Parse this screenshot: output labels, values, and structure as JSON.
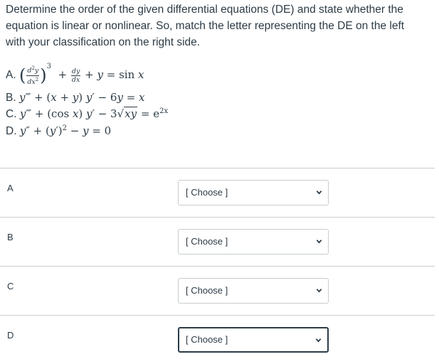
{
  "question": {
    "prompt_lines": [
      "Determine the order of the given differential equations (DE) and state whether the",
      "equation is linear or nonlinear. So, match the letter representing the DE on the left",
      "with your classification on the right side."
    ]
  },
  "equations": [
    {
      "letter": "A.",
      "latex": "(d^2y/dx^2)^3 + dy/dx + y = sin x"
    },
    {
      "letter": "B.",
      "latex": "y''' + (x + y) y' − 6y = x"
    },
    {
      "letter": "C.",
      "latex": "y''' + (cos x) y' − 3√(xy) = e^(2x)"
    },
    {
      "letter": "D.",
      "latex": "y'' + (y')^2 − y = 0"
    }
  ],
  "matches": [
    {
      "label": "A",
      "selected": "[ Choose ]"
    },
    {
      "label": "B",
      "selected": "[ Choose ]"
    },
    {
      "label": "C",
      "selected": "[ Choose ]"
    },
    {
      "label": "D",
      "selected": "[ Choose ]"
    }
  ],
  "colors": {
    "text": "#2d3b45",
    "divider": "#c7cdd1",
    "focus_border": "#2d3b45"
  },
  "icons": {
    "dropdown": "chevron-down-icon"
  }
}
